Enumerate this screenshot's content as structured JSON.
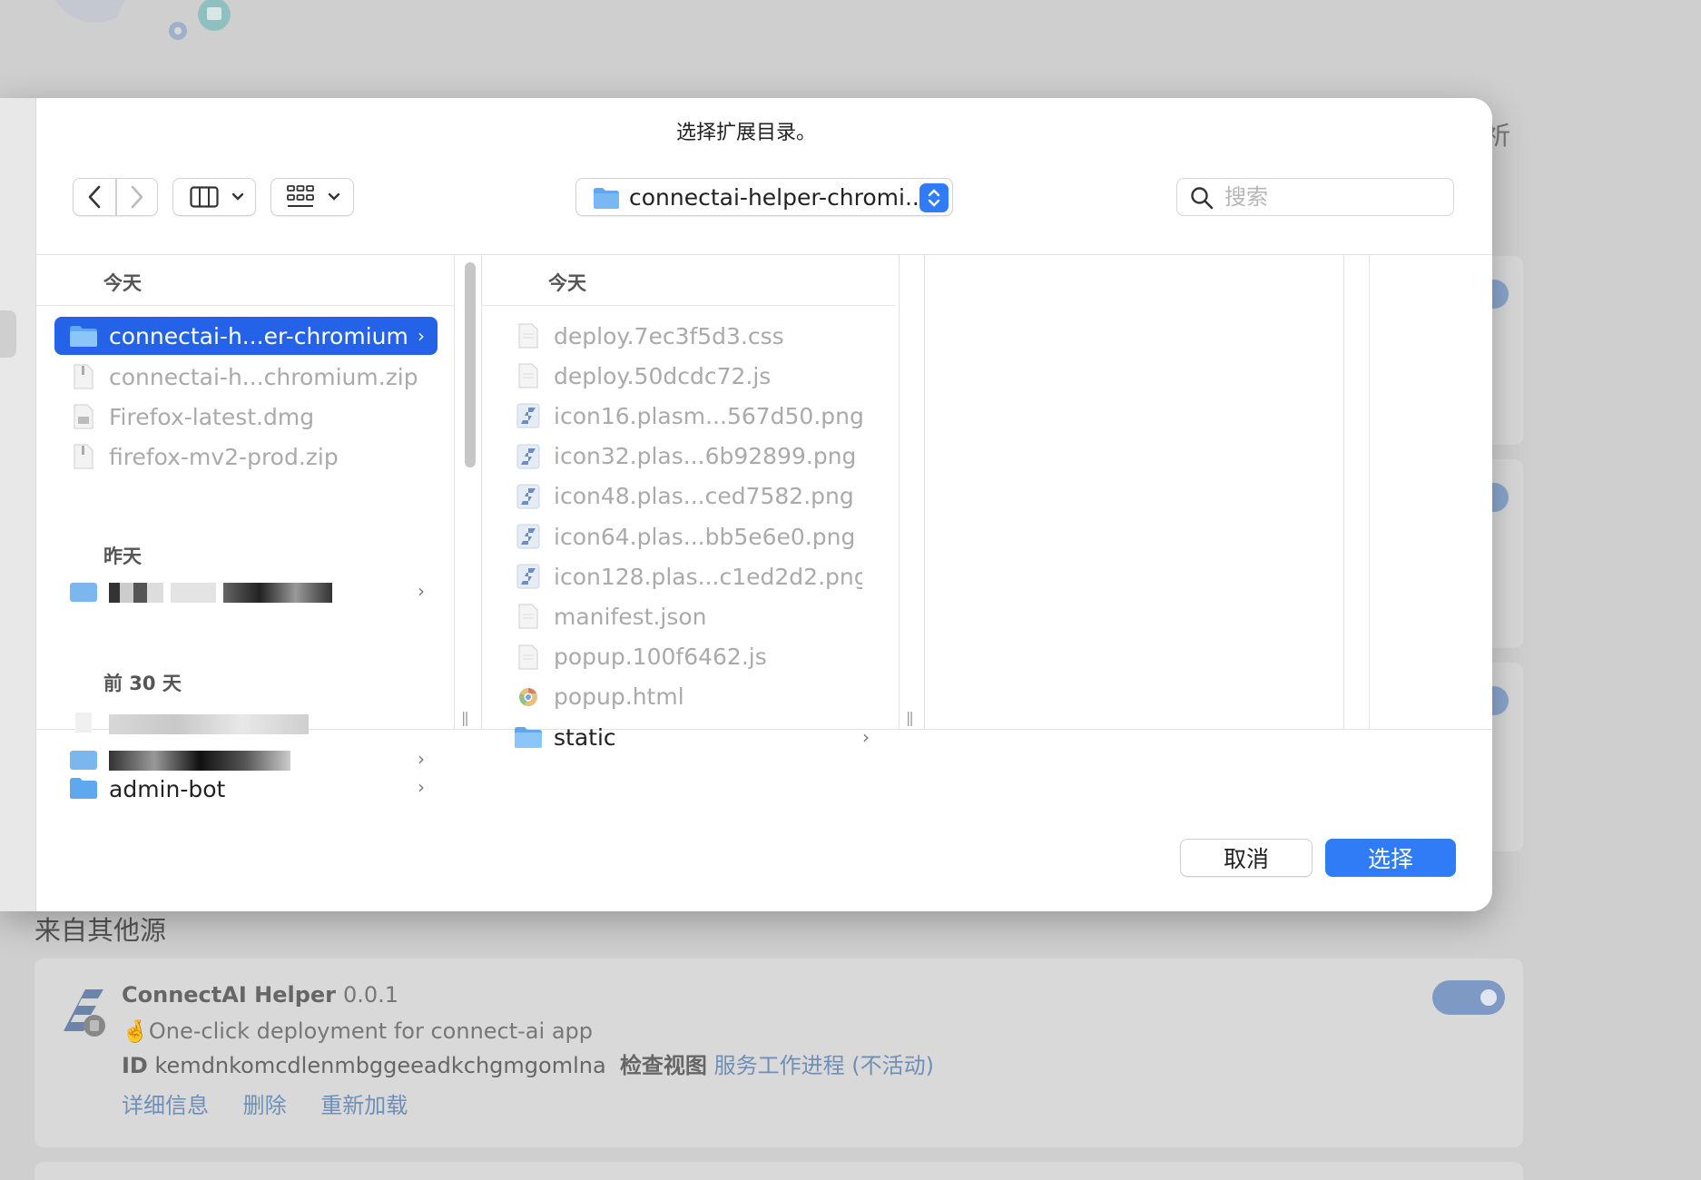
{
  "background": {
    "right_partial_char": "祈",
    "section_title": "来自其他源",
    "extension": {
      "name": "ConnectAI Helper",
      "version": "0.0.1",
      "description": "🤞One-click deployment for connect-ai app",
      "id_label": "ID",
      "id_value": "kemdnkomcdlenmbggeeadkchgmgomlna",
      "inspect_label": "检查视图",
      "service_worker_link": "服务工作进程 (不活动)",
      "actions": [
        "详细信息",
        "删除",
        "重新加载"
      ],
      "enabled": true
    }
  },
  "dialog": {
    "title": "选择扩展目录。",
    "path_popup": "connectai-helper-chromi...",
    "search_placeholder": "搜索",
    "column1": {
      "header": "今天",
      "today_items": [
        {
          "name": "connectai-h...er-chromium",
          "type": "folder",
          "selected": true
        },
        {
          "name": "connectai-h...chromium.zip",
          "type": "zip"
        },
        {
          "name": "Firefox-latest.dmg",
          "type": "dmg"
        },
        {
          "name": "firefox-mv2-prod.zip",
          "type": "zip"
        }
      ],
      "group_yesterday": "昨天",
      "group_30days": "前 30 天",
      "last_item": "admin-bot"
    },
    "column2": {
      "header": "今天",
      "items": [
        {
          "name": "deploy.7ec3f5d3.css",
          "type": "file"
        },
        {
          "name": "deploy.50dcdc72.js",
          "type": "file"
        },
        {
          "name": "icon16.plasm...567d50.png",
          "type": "image"
        },
        {
          "name": "icon32.plas...6b92899.png",
          "type": "image"
        },
        {
          "name": "icon48.plas...ced7582.png",
          "type": "image"
        },
        {
          "name": "icon64.plas...bb5e6e0.png",
          "type": "image"
        },
        {
          "name": "icon128.plas...c1ed2d2.png",
          "type": "image"
        },
        {
          "name": "manifest.json",
          "type": "file"
        },
        {
          "name": "popup.100f6462.js",
          "type": "file"
        },
        {
          "name": "popup.html",
          "type": "html"
        },
        {
          "name": "static",
          "type": "folder"
        }
      ]
    },
    "cancel_label": "取消",
    "choose_label": "选择"
  },
  "colors": {
    "accent": "#2f7cf6",
    "selection": "#2462e8",
    "folder": "#5fa8f0"
  }
}
